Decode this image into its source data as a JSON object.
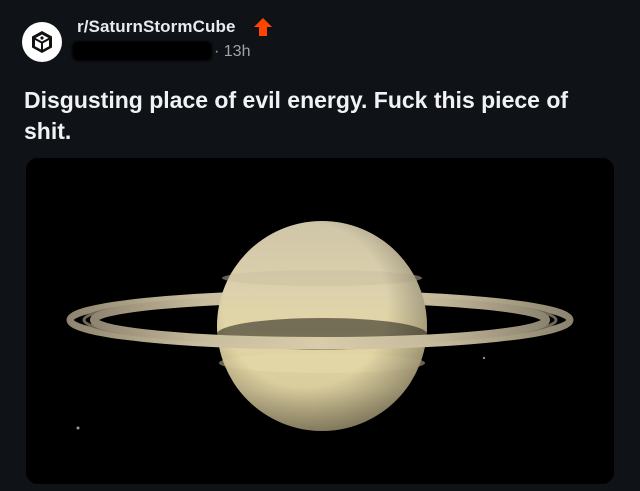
{
  "post": {
    "subreddit": "r/SaturnStormCube",
    "time_ago": "13h",
    "meta_separator": "·",
    "title": "Disgusting place of evil energy. Fuck this piece of shit.",
    "image_subject": "planet-saturn"
  },
  "colors": {
    "background": "#0f1317",
    "upvote_accent": "#ff4500",
    "title_text": "#f1f2f3",
    "meta_text": "#9ea3a8"
  },
  "icons": {
    "avatar": "cube-logo-icon",
    "vote": "upvote-arrow-icon"
  }
}
